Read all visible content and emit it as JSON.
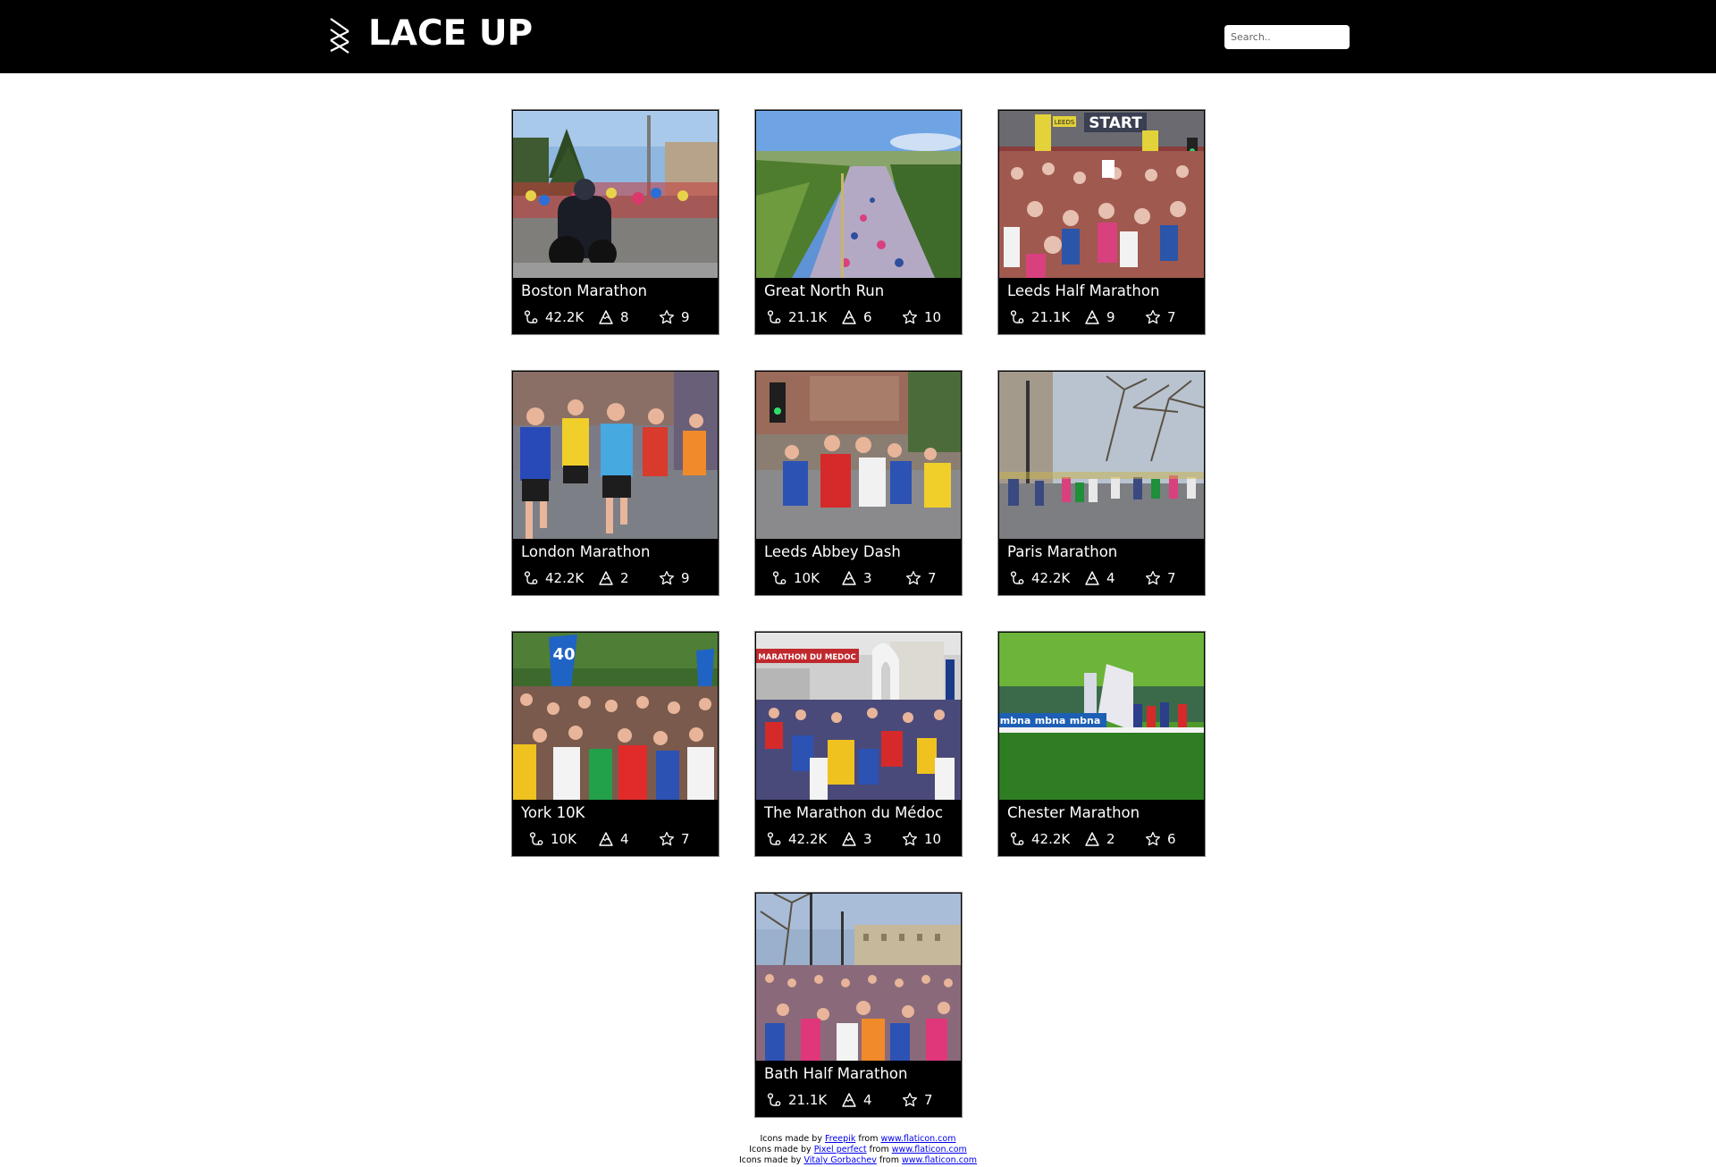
{
  "header": {
    "logo_text": "LACE UP",
    "search_placeholder": "Search.."
  },
  "icons": {
    "distance": "runner-route-icon",
    "elevation": "mountain-icon",
    "rating": "star-outline-icon"
  },
  "colors": {
    "header_bg": "#000000",
    "card_bg": "#000000",
    "text_light": "#ffffff",
    "link": "#0000ee"
  },
  "races": [
    {
      "name": "Boston Marathon",
      "distance": "42.2K",
      "elevation": "8",
      "rating": "9"
    },
    {
      "name": "Great North Run",
      "distance": "21.1K",
      "elevation": "6",
      "rating": "10"
    },
    {
      "name": "Leeds Half Marathon",
      "distance": "21.1K",
      "elevation": "9",
      "rating": "7"
    },
    {
      "name": "London Marathon",
      "distance": "42.2K",
      "elevation": "2",
      "rating": "9"
    },
    {
      "name": "Leeds Abbey Dash",
      "distance": "10K",
      "elevation": "3",
      "rating": "7"
    },
    {
      "name": "Paris Marathon",
      "distance": "42.2K",
      "elevation": "4",
      "rating": "7"
    },
    {
      "name": "York 10K",
      "distance": "10K",
      "elevation": "4",
      "rating": "7"
    },
    {
      "name": "The Marathon du Médoc",
      "distance": "42.2K",
      "elevation": "3",
      "rating": "10"
    },
    {
      "name": "Chester Marathon",
      "distance": "42.2K",
      "elevation": "2",
      "rating": "6"
    },
    {
      "name": "Bath Half Marathon",
      "distance": "21.1K",
      "elevation": "4",
      "rating": "7"
    }
  ],
  "photo_text": {
    "start_banner": "START",
    "leeds_flag": "LEEDS",
    "york_flag": "40",
    "medoc_banner": "MARATHON DU MEDOC",
    "chester_banner": "mbna"
  },
  "footer": {
    "lines": [
      {
        "prefix": "Icons made by ",
        "author": "Freepik",
        "mid": " from ",
        "site": "www.flaticon.com"
      },
      {
        "prefix": "Icons made by ",
        "author": "Pixel perfect",
        "mid": " from ",
        "site": "www.flaticon.com"
      },
      {
        "prefix": "Icons made by ",
        "author": "Vitaly Gorbachev",
        "mid": " from ",
        "site": "www.flaticon.com"
      }
    ]
  }
}
